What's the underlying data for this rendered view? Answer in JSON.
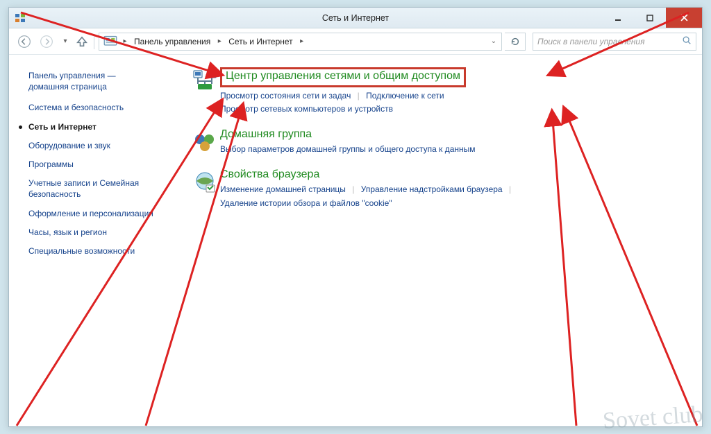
{
  "titlebar": {
    "title": "Сеть и Интернет"
  },
  "breadcrumb": {
    "seg1": "Панель управления",
    "seg2": "Сеть и Интернет"
  },
  "search": {
    "placeholder": "Поиск в панели управления"
  },
  "sidebar": {
    "home_line1": "Панель управления —",
    "home_line2": "домашняя страница",
    "items": [
      {
        "label": "Система и безопасность",
        "active": false
      },
      {
        "label": "Сеть и Интернет",
        "active": true
      },
      {
        "label": "Оборудование и звук",
        "active": false
      },
      {
        "label": "Программы",
        "active": false
      },
      {
        "label": "Учетные записи и Семейная безопасность",
        "active": false
      },
      {
        "label": "Оформление и персонализация",
        "active": false
      },
      {
        "label": "Часы, язык и регион",
        "active": false
      },
      {
        "label": "Специальные возможности",
        "active": false
      }
    ]
  },
  "main": {
    "network_center": {
      "title": "Центр управления сетями и общим доступом",
      "links": [
        "Просмотр состояния сети и задач",
        "Подключение к сети",
        "Просмотр сетевых компьютеров и устройств"
      ]
    },
    "homegroup": {
      "title": "Домашняя группа",
      "links": [
        "Выбор параметров домашней группы и общего доступа к данным"
      ]
    },
    "browser": {
      "title": "Свойства браузера",
      "links": [
        "Изменение домашней страницы",
        "Управление надстройками браузера",
        "Удаление истории обзора и файлов \"cookie\""
      ]
    }
  },
  "watermark": "Sovet club"
}
